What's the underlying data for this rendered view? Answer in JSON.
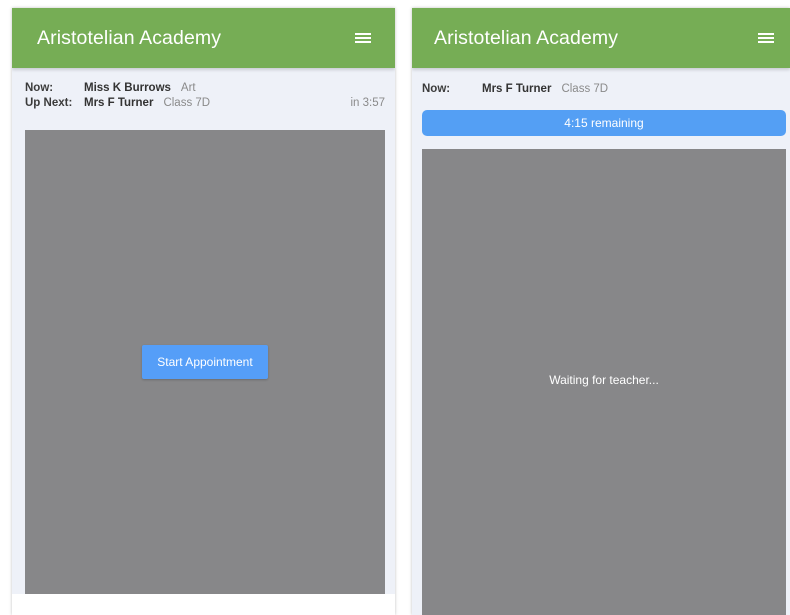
{
  "screens": [
    {
      "app_title": "Aristotelian Academy",
      "menu_icon": "hamburger-menu-icon",
      "now": {
        "label": "Now:",
        "name": "Miss K Burrows",
        "detail": "Art"
      },
      "up_next": {
        "label": "Up Next:",
        "name": "Mrs F Turner",
        "detail": "Class 7D",
        "countdown": "in 3:57"
      },
      "start_button_label": "Start Appointment"
    },
    {
      "app_title": "Aristotelian Academy",
      "menu_icon": "hamburger-menu-icon",
      "now": {
        "label": "Now:",
        "name": "Mrs F Turner",
        "detail": "Class 7D"
      },
      "remaining_label": "4:15 remaining",
      "waiting_text": "Waiting for teacher..."
    }
  ],
  "colors": {
    "header": "#76ad55",
    "accent_blue": "#559ef8",
    "video_bg": "#878789",
    "panel_bg": "#eef1f8"
  }
}
